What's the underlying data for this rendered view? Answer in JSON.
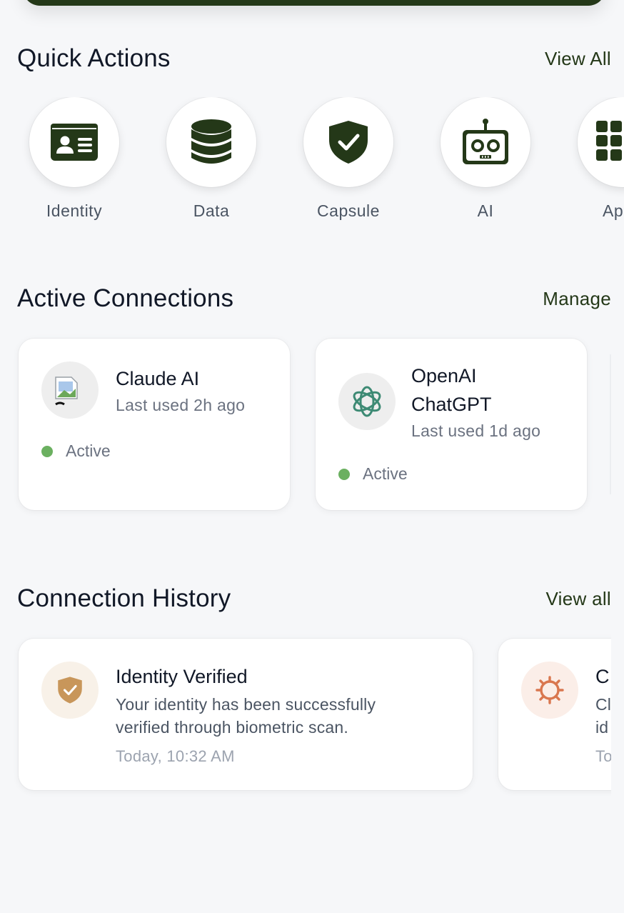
{
  "quick_actions": {
    "title": "Quick Actions",
    "view_all": "View All",
    "items": [
      {
        "label": "Identity",
        "icon": "id-card-icon"
      },
      {
        "label": "Data",
        "icon": "database-icon"
      },
      {
        "label": "Capsule",
        "icon": "shield-check-icon"
      },
      {
        "label": "AI",
        "icon": "robot-icon"
      },
      {
        "label": "Ap",
        "icon": "apps-grid-icon"
      }
    ]
  },
  "active_connections": {
    "title": "Active Connections",
    "manage": "Manage",
    "items": [
      {
        "name": "Claude AI",
        "last_used": "Last used 2h ago",
        "status": "Active",
        "icon": "broken-image-icon"
      },
      {
        "name_line1": "OpenAI",
        "name_line2": "ChatGPT",
        "last_used": "Last used 1d ago",
        "status": "Active",
        "icon": "openai-logo-icon"
      }
    ]
  },
  "connection_history": {
    "title": "Connection History",
    "view_all": "View all",
    "items": [
      {
        "title": "Identity Verified",
        "desc_line1": "Your identity has been successfully",
        "desc_line2": "verified through biometric scan.",
        "time": "Today, 10:32 AM",
        "icon": "shield-check-icon"
      },
      {
        "title": "C",
        "desc_line1": "Cl",
        "desc_line2": "id",
        "time": "To",
        "icon": "claude-logo-icon"
      }
    ]
  },
  "colors": {
    "brand": "#243818",
    "active": "#6bb060",
    "history_gold": "#c8965a",
    "history_orange": "#d9774f"
  }
}
